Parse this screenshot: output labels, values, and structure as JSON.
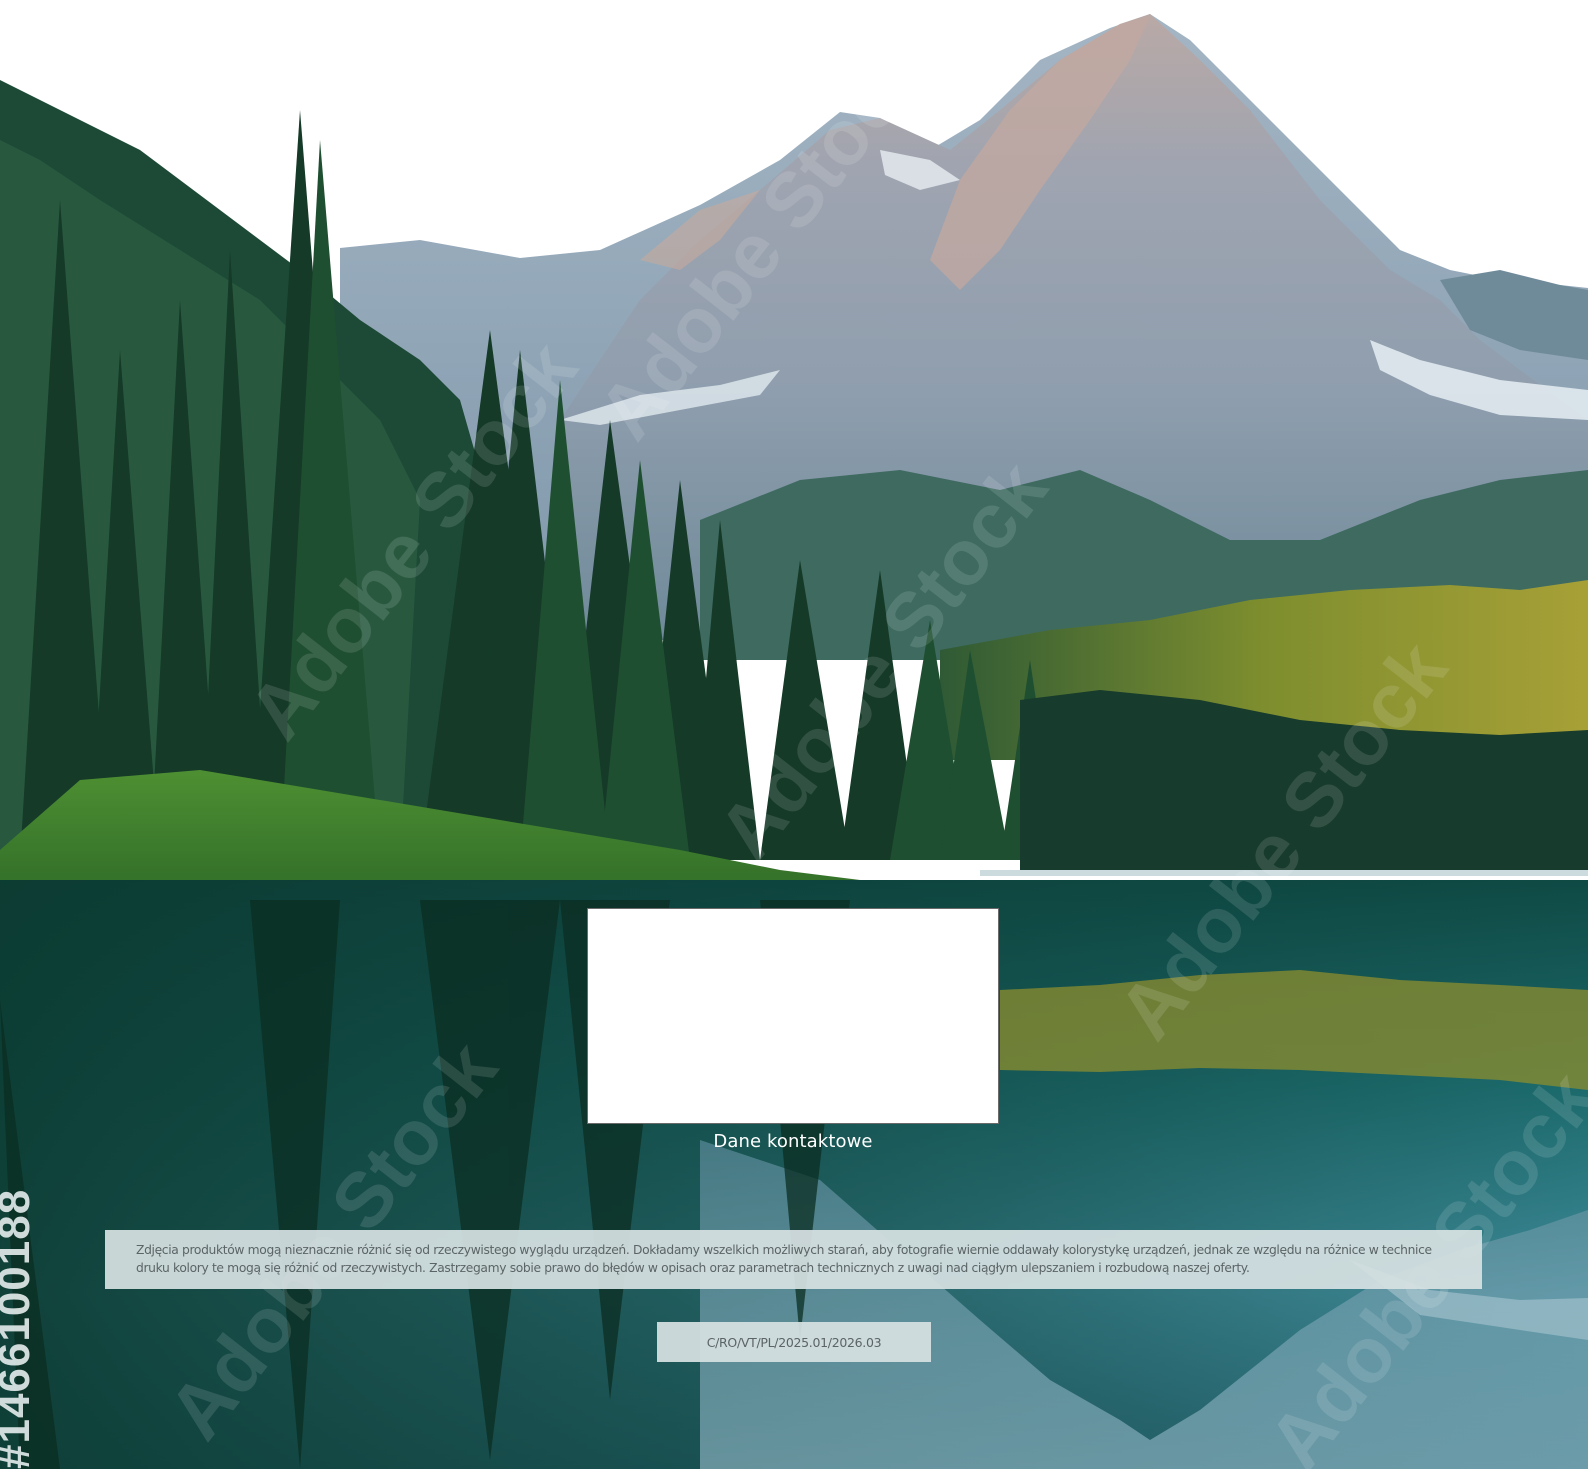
{
  "contact": {
    "label": "Dane kontaktowe"
  },
  "disclaimer": {
    "text": "Zdjęcia produktów mogą nieznacznie różnić się od rzeczywistego wyglądu urządzeń. Dokładamy wszelkich możliwych starań, aby fotografie wiernie oddawały kolorystykę urządzeń, jednak ze względu na różnice w technice druku kolory te mogą się różnić od rzeczywistych. Zastrzegamy sobie prawo do błędów w opisach oraz parametrach technicznych z uwagi nad ciągłym ulepszaniem i rozbudową naszej oferty."
  },
  "document_code": "C/RO/VT/PL/2025.01/2026.03",
  "background": {
    "image_id_mark": "#1466100188",
    "watermark_text": "Adobe Stock"
  }
}
